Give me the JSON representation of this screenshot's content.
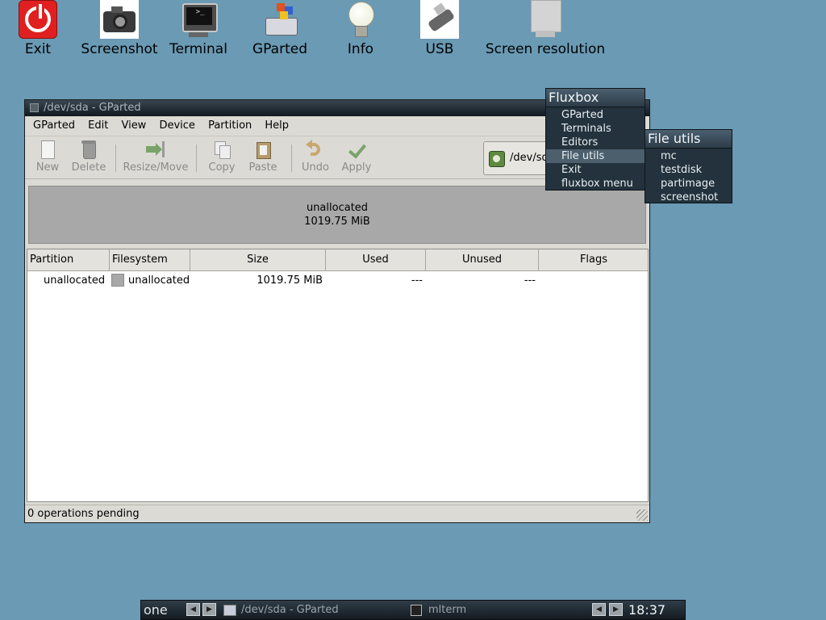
{
  "desktop": {
    "icons": [
      {
        "label": "Exit",
        "icon": "power-icon"
      },
      {
        "label": "Screenshot",
        "icon": "camera-icon"
      },
      {
        "label": "Terminal",
        "icon": "terminal-icon"
      },
      {
        "label": "GParted",
        "icon": "gparted-icon"
      },
      {
        "label": "Info",
        "icon": "lightbulb-icon"
      },
      {
        "label": "USB",
        "icon": "usb-icon"
      },
      {
        "label": "Screen resolution",
        "icon": "monitor-icon"
      }
    ]
  },
  "window": {
    "title": "/dev/sda - GParted",
    "menu": {
      "gparted": "GParted",
      "edit": "Edit",
      "view": "View",
      "device": "Device",
      "partition": "Partition",
      "help": "Help"
    },
    "toolbar": {
      "new": "New",
      "delete": "Delete",
      "resize": "Resize/Move",
      "copy": "Copy",
      "paste": "Paste",
      "undo": "Undo",
      "apply": "Apply"
    },
    "device_selector": "/dev/sda",
    "graph": {
      "label": "unallocated",
      "size": "1019.75 MiB"
    },
    "table": {
      "headers": {
        "partition": "Partition",
        "filesystem": "Filesystem",
        "size": "Size",
        "used": "Used",
        "unused": "Unused",
        "flags": "Flags"
      },
      "rows": [
        {
          "partition": "unallocated",
          "filesystem": "unallocated",
          "size": "1019.75 MiB",
          "used": "---",
          "unused": "---",
          "flags": ""
        }
      ]
    },
    "status": "0 operations pending"
  },
  "fluxbox_menu": {
    "title": "Fluxbox",
    "items": [
      "GParted",
      "Terminals",
      "Editors",
      "File utils",
      "Exit",
      "fluxbox menu"
    ],
    "selected": "File utils"
  },
  "file_utils_menu": {
    "title": "File utils",
    "items": [
      "mc",
      "testdisk",
      "partimage",
      "screenshot"
    ]
  },
  "taskbar": {
    "workspace": "one",
    "tasks": [
      "/dev/sda - GParted",
      "mlterm"
    ],
    "clock": "18:37"
  },
  "colors": {
    "desktop": "#6a9ab4",
    "menu_bg": "#23323c",
    "menu_selected": "#4c5f6c"
  }
}
